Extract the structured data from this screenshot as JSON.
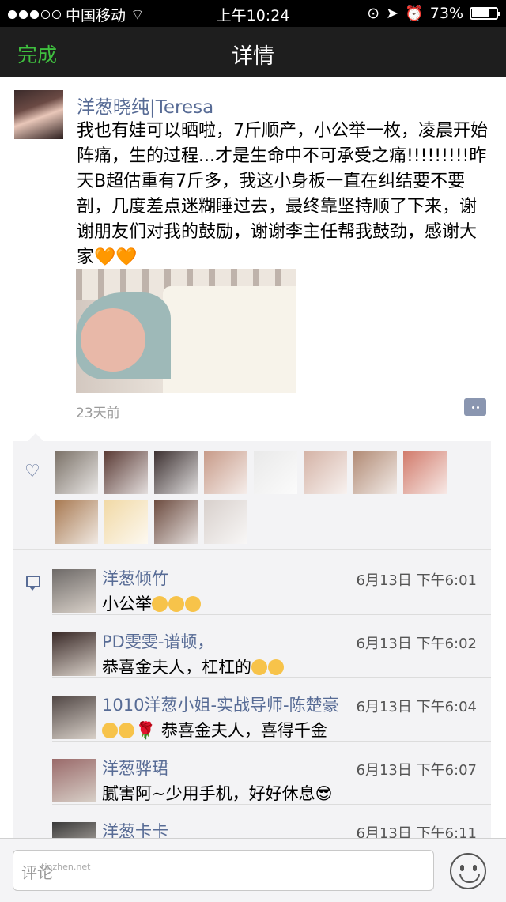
{
  "status_bar": {
    "carrier": "中国移动",
    "time": "上午10:24",
    "battery": "73%",
    "battery_level": 0.73
  },
  "nav": {
    "done_label": "完成",
    "title": "详情"
  },
  "post": {
    "author": "洋葱晓纯|Teresa",
    "content": "我也有娃可以晒啦，7斤顺产，小公举一枚，凌晨开始阵痛，生的过程...才是生命中不可承受之痛!!!!!!!!!昨天B超估重有7斤多，我这小身板一直在纠结要不要剖，几度差点迷糊睡过去，最终靠坚持顺了下来，谢谢朋友们对我的鼓励，谢谢李主任帮我鼓劲，感谢大家",
    "hearts": "🧡🧡",
    "time_ago": "23天前"
  },
  "likes": {
    "count": 12,
    "avatar_colors": [
      "#7a7066",
      "#5a3a34",
      "#3c3030",
      "#c79a88",
      "#e9e9e9",
      "#d4b2a5",
      "#b18a74",
      "#d17a6a",
      "#a87a52",
      "#f1d9a6",
      "#6d4c40",
      "#d8d0cc"
    ]
  },
  "comments": [
    {
      "name": "洋葱倾竹",
      "date": "6月13日 下午6:01",
      "text": "小公举",
      "emoji_count": 3,
      "avatar_color": "#6e6a68"
    },
    {
      "name": "PD雯雯-谱顿，",
      "date": "6月13日 下午6:02",
      "text": "恭喜金夫人，杠杠的",
      "emoji_count": 2,
      "avatar_color": "#3a2a28"
    },
    {
      "name": "1010洋葱小姐-实战导师-陈楚豪",
      "date": "6月13日 下午6:04",
      "text": "恭喜金夫人，喜得千金",
      "emoji_count": 2,
      "rose": "🌹",
      "avatar_color": "#504644"
    },
    {
      "name": "洋葱骅珺",
      "date": "6月13日 下午6:07",
      "text": "腻害阿~少用手机，好好休息😎",
      "emoji_count": 0,
      "avatar_color": "#9a6a6a"
    },
    {
      "name": "洋葱卡卡",
      "date": "6月13日 下午6:11",
      "text": "",
      "emoji_count": 0,
      "avatar_color": "#3a3a3a"
    }
  ],
  "input": {
    "placeholder": "评论",
    "watermark": "jtinzhen.net"
  }
}
